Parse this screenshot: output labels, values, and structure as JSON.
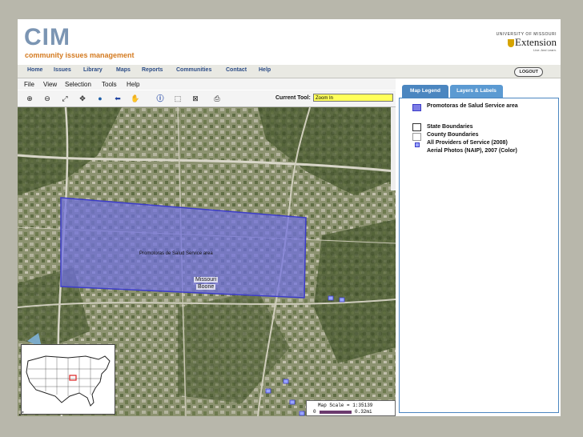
{
  "header": {
    "logo": "CIM",
    "tagline": "community issues management",
    "partner_top": "UNIVERSITY OF MISSOURI",
    "partner_name": "Extension",
    "partner_motto": "Live. And Learn."
  },
  "nav": {
    "items": [
      "Home",
      "Issues",
      "Library",
      "Maps",
      "Reports",
      "Communities",
      "Contact",
      "Help"
    ],
    "logout": "LOGOUT"
  },
  "menu": {
    "items": [
      "File",
      "View",
      "Selection",
      "Tools",
      "Help"
    ]
  },
  "toolbar": {
    "current_tool_label": "Current Tool:",
    "current_tool_value": "Zoom In",
    "icons": [
      "zoom-in-icon",
      "zoom-out-icon",
      "full-extent-icon",
      "pan-extent-icon",
      "globe-icon",
      "back-arrow-icon",
      "hand-icon",
      "info-icon",
      "select-icon",
      "clear-icon",
      "print-icon"
    ]
  },
  "map": {
    "region_label": "Promotoras de Salud Service area",
    "place_label_1": "Missouri",
    "place_label_2": "Boone",
    "scale_text": "Map Scale = 1:35139",
    "scale_zero": "0",
    "scale_end": "0.32mi",
    "colors": {
      "service_area": "#6f6fe0",
      "service_area_border": "#3c3cc8",
      "aerial_base": "#7a8a60"
    }
  },
  "sidebar": {
    "tabs": [
      "Map Legend",
      "Layers & Labels"
    ],
    "legend": [
      {
        "label": "Promotoras de Salud Service area",
        "swatch": "#7d7de6"
      },
      {
        "label": "State Boundaries",
        "swatch": "#ffffff"
      },
      {
        "label": "County Boundaries",
        "swatch": "#ffffff"
      },
      {
        "label": "All Providers of Service (2008)",
        "swatch": "#9aa6ff"
      },
      {
        "label": "Aerial Photos (NAIP), 2007 (Color)",
        "swatch": "none"
      }
    ]
  }
}
